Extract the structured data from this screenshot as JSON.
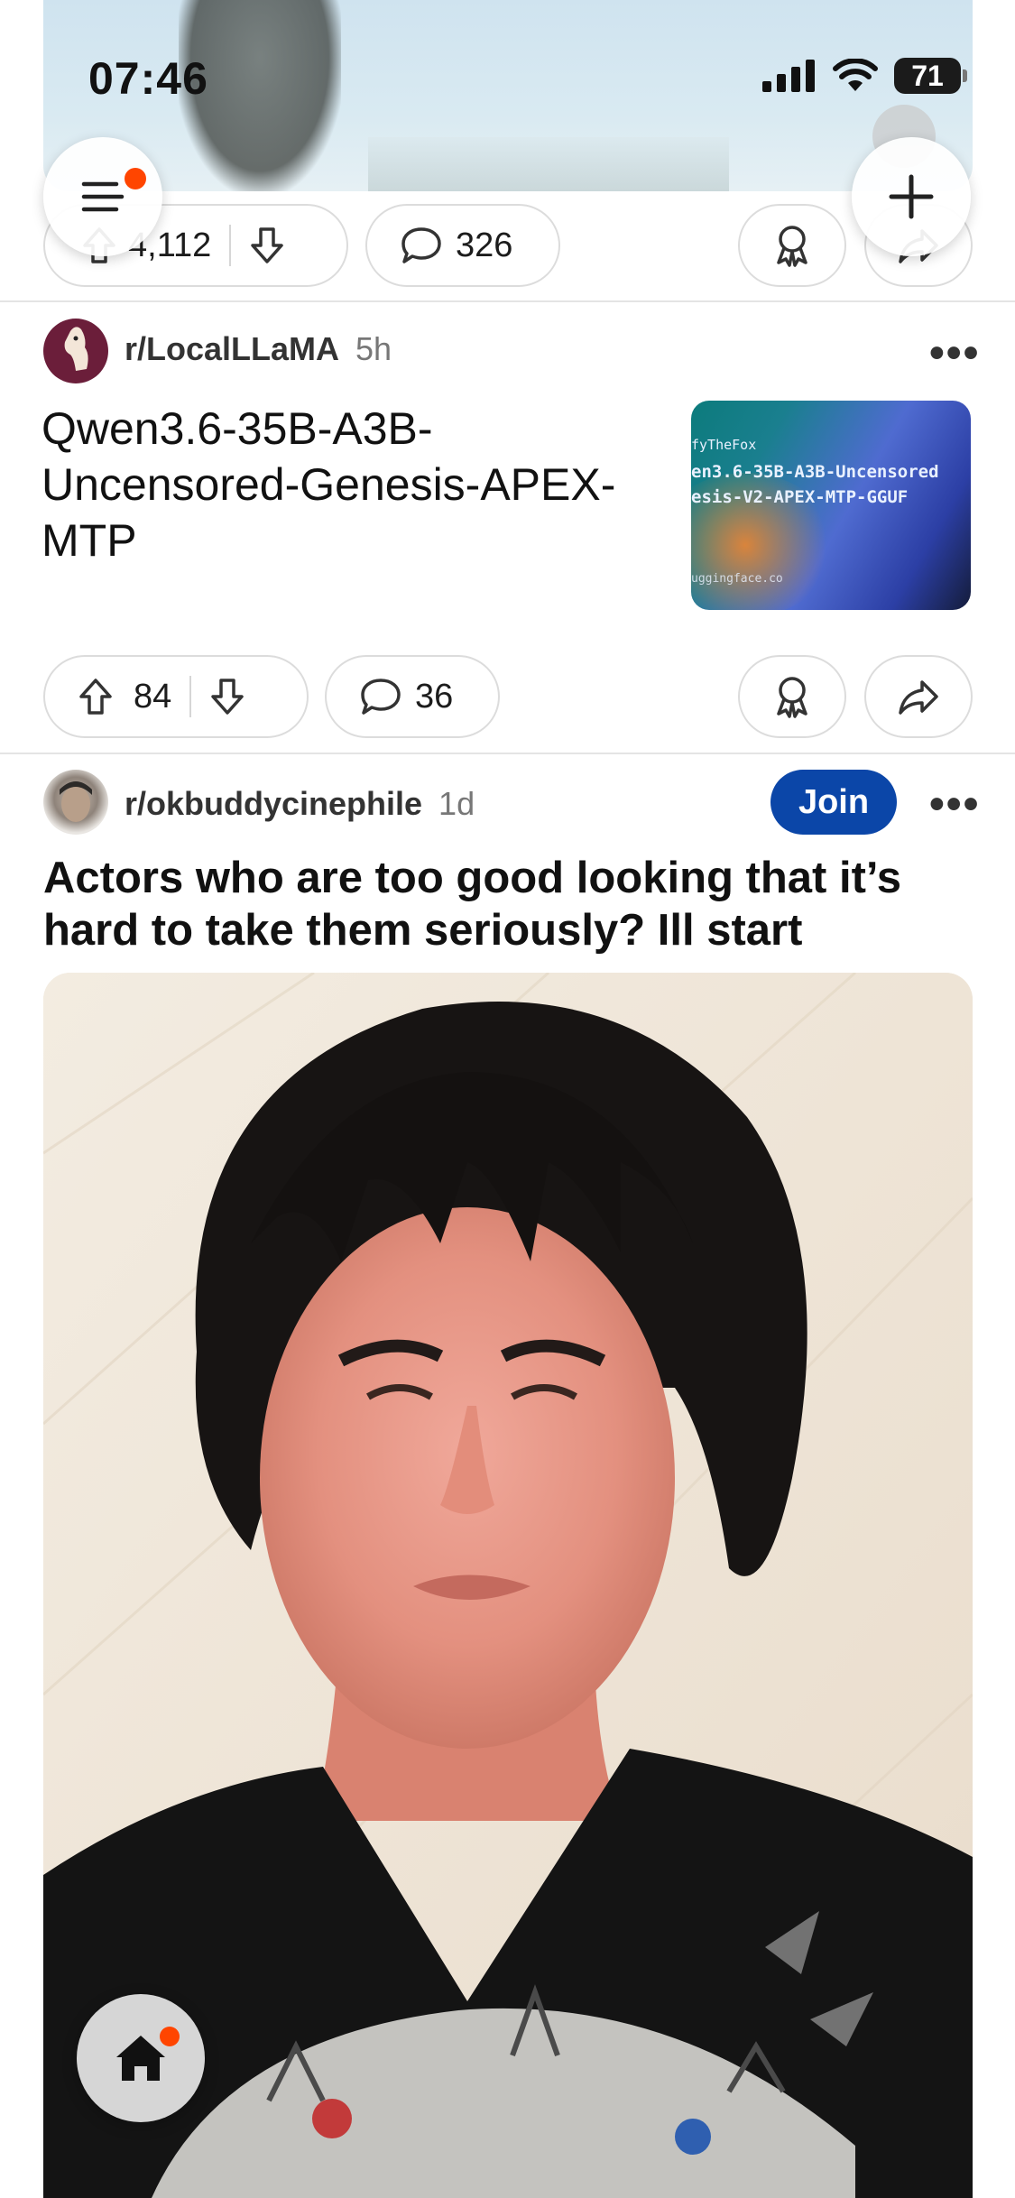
{
  "status_bar": {
    "time": "07:46",
    "battery": "71"
  },
  "top_post": {
    "upvotes": "4,112",
    "comments": "326"
  },
  "post1": {
    "subreddit": "r/LocalLLaMA",
    "age": "5h",
    "title_lines": [
      "Qwen3.6-35B-A3B-",
      "Uncensored-Genesis-APEX-",
      "MTP"
    ],
    "thumbnail": {
      "line1": "fyTheFox",
      "line2": "en3.6-35B-A3B-Uncensored",
      "line3": "esis-V2-APEX-MTP-GGUF",
      "domain": "uggingface.co"
    },
    "upvotes": "84",
    "comments": "36",
    "more": "•••"
  },
  "post2": {
    "subreddit": "r/okbuddycinephile",
    "age": "1d",
    "join_label": "Join",
    "more": "•••",
    "title_lines": [
      "Actors who are too good looking that it’s",
      "hard to take them seriously? Ill start"
    ]
  },
  "icons": {
    "menu": "menu-icon",
    "create": "plus-icon",
    "upvote": "arrow-up-icon",
    "downvote": "arrow-down-icon",
    "comment": "comment-icon",
    "award": "award-icon",
    "share": "share-icon",
    "home": "home-icon"
  },
  "colors": {
    "accent": "#ff4500",
    "join": "#0b46a8"
  }
}
